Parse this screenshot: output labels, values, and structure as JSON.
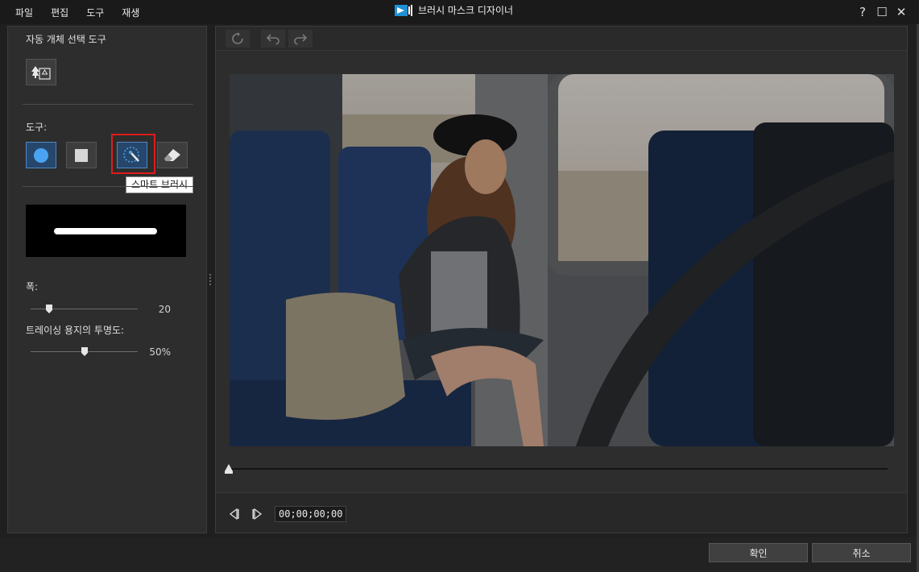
{
  "menu": [
    "파일",
    "편집",
    "도구",
    "재생"
  ],
  "app": {
    "title": "브러시 마스크 디자이너"
  },
  "window_controls": {
    "help": "?",
    "maximize": "☐",
    "close": "✕"
  },
  "left_panel": {
    "auto_select_label": "자동 개체 선택 도구",
    "tools_label": "도구:",
    "tools": [
      {
        "name": "circle-brush",
        "icon": "circle-icon",
        "active": true
      },
      {
        "name": "square-brush",
        "icon": "square-icon",
        "active": false
      },
      {
        "name": "smart-brush",
        "icon": "smart-brush-icon",
        "active": false,
        "highlighted": true
      },
      {
        "name": "eraser",
        "icon": "eraser-icon",
        "active": false
      }
    ],
    "tooltip": "스마트 브러시",
    "width_label": "폭:",
    "width_value": "20",
    "width_fraction": 0.17,
    "opacity_label": "트레이싱 용지의 투명도:",
    "opacity_value": "50%",
    "opacity_fraction": 0.5
  },
  "viewer": {
    "toolbar": [
      "reset-icon",
      "undo-icon",
      "redo-icon"
    ],
    "timecode": "00;00;00;00",
    "timeline_fraction": 0
  },
  "buttons": {
    "ok": "확인",
    "cancel": "취소"
  },
  "colors": {
    "accent": "#4e86c4",
    "highlight": "#e01b1b",
    "circle_tool": "#4aa3f0"
  }
}
